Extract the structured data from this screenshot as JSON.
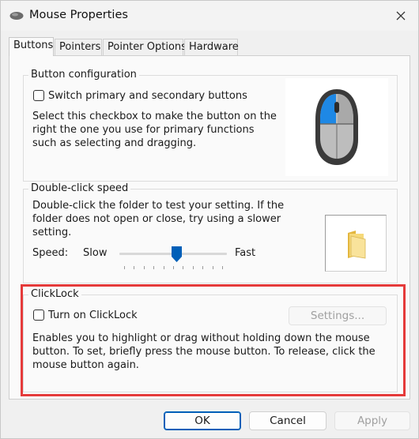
{
  "window": {
    "title": "Mouse Properties",
    "close_icon": "close-icon"
  },
  "tabs": [
    {
      "label": "Buttons",
      "active": true
    },
    {
      "label": "Pointers",
      "active": false
    },
    {
      "label": "Pointer Options",
      "active": false
    },
    {
      "label": "Hardware",
      "active": false
    }
  ],
  "button_config": {
    "title": "Button configuration",
    "checkbox_label": "Switch primary and secondary buttons",
    "checked": false,
    "description": "Select this checkbox to make the button on the right the one you use for primary functions such as selecting and dragging.",
    "image_icon": "mouse-icon"
  },
  "double_click": {
    "title": "Double-click speed",
    "description": "Double-click the folder to test your setting. If the folder does not open or close, try using a slower setting.",
    "speed_label": "Speed:",
    "slow_label": "Slow",
    "fast_label": "Fast",
    "speed_fraction": 0.5,
    "test_icon": "folder-icon"
  },
  "clicklock": {
    "title": "ClickLock",
    "checkbox_label": "Turn on ClickLock",
    "checked": false,
    "settings_label": "Settings...",
    "description": "Enables you to highlight or drag without holding down the mouse button. To set, briefly press the mouse button. To release, click the mouse button again."
  },
  "footer": {
    "ok_label": "OK",
    "cancel_label": "Cancel",
    "apply_label": "Apply"
  },
  "colors": {
    "highlight_border": "#e53a3a",
    "accent": "#005fb8",
    "mouse_primary": "#1e88e5"
  }
}
